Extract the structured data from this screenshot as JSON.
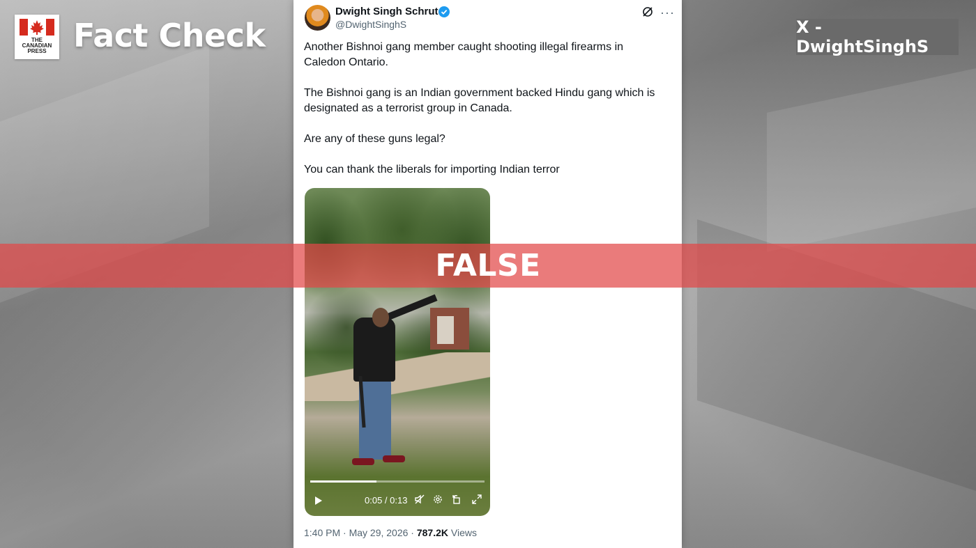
{
  "header": {
    "logo_line1": "THE",
    "logo_line2": "CANADIAN",
    "logo_line3": "PRESS",
    "title": "Fact Check",
    "source_tag": "X - DwightSinghS"
  },
  "tweet": {
    "display_name": "Dwight Singh Schrute",
    "handle": "@DwightSinghS",
    "paragraphs": [
      "Another Bishnoi gang member caught shooting illegal firearms in Caledon Ontario.",
      "The Bishnoi gang is an Indian government backed Hindu gang which is designated as a terrorist group in Canada.",
      "Are any of these guns legal?",
      "You can thank the liberals for importing Indian terror"
    ],
    "video": {
      "time": "0:05 / 0:13",
      "progress": 0.38,
      "icons": [
        "play-icon",
        "mute-icon",
        "settings-icon",
        "rotate-icon",
        "fullscreen-icon"
      ]
    },
    "timestamp": "1:40 PM · May 29, 2026 · ",
    "views_count": "787.2K",
    "views_label": " Views"
  },
  "verdict": {
    "label": "FALSE",
    "color": "#e24848"
  },
  "colors": {
    "verified": "#1d9bf0",
    "brand_red": "#d52b1e"
  }
}
